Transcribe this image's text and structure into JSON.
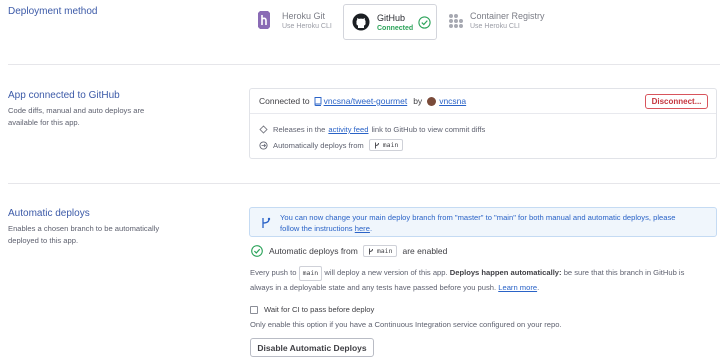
{
  "deployment_method": {
    "title": "Deployment method",
    "options": [
      {
        "name": "Heroku Git",
        "sub": "Use Heroku CLI"
      },
      {
        "name": "GitHub",
        "sub": "Connected"
      },
      {
        "name": "Container Registry",
        "sub": "Use Heroku CLI"
      }
    ]
  },
  "github": {
    "title": "App connected to GitHub",
    "desc": "Code diffs, manual and auto deploys are available for this app.",
    "connected_to": "Connected to",
    "repo": "vncsna/tweet-gourmet",
    "by": "by",
    "user": "vncsna",
    "disconnect": "Disconnect...",
    "releases_prefix": "Releases in the",
    "activity_feed": "activity feed",
    "releases_suffix": "link to GitHub to view commit diffs",
    "auto_deploys_from": "Automatically deploys from",
    "branch": "main"
  },
  "auto": {
    "title": "Automatic deploys",
    "desc": "Enables a chosen branch to be automatically deployed to this app.",
    "notice_line1": "You can now change your main deploy branch from \"master\" to \"main\" for both manual and automatic deploys, please",
    "notice_line2_prefix": "follow the instructions",
    "notice_link": "here",
    "notice_line2_suffix": ".",
    "enabled_prefix": "Automatic deploys from",
    "enabled_branch": "main",
    "enabled_suffix": "are enabled",
    "every_push_1": "Every push to",
    "every_push_branch": "main",
    "every_push_2": "will deploy a new version of this app.",
    "every_push_bold": "Deploys happen automatically:",
    "every_push_3": "be sure that this branch in GitHub is",
    "every_push_line2": "always in a deployable state and any tests have passed before you push.",
    "learn_more": "Learn more",
    "learn_more_suffix": ".",
    "wait_ci": "Wait for CI to pass before deploy",
    "ci_note": "Only enable this option if you have a Continuous Integration service configured on your repo.",
    "disable_button": "Disable Automatic Deploys"
  },
  "colors": {
    "accent": "#3c5aa8",
    "success": "#2ca35a",
    "danger": "#c5343d",
    "notice_bg": "#f0f6fc"
  }
}
